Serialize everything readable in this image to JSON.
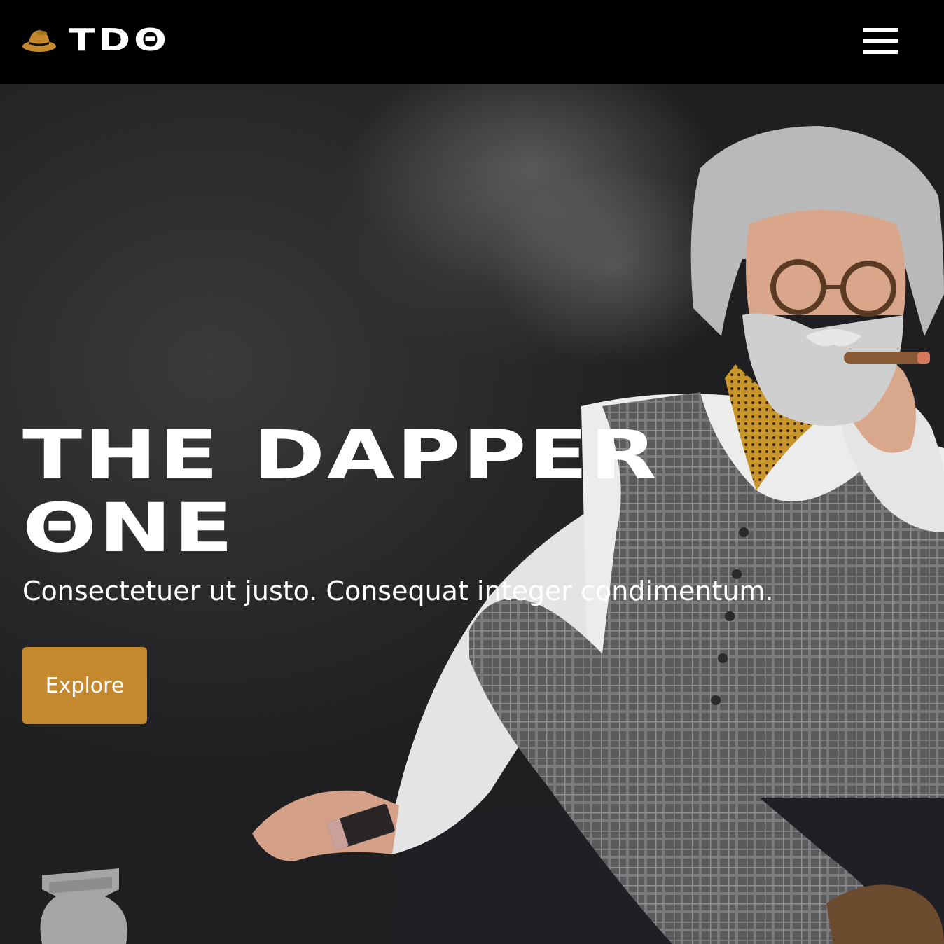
{
  "header": {
    "logo_text": "TDΘ",
    "logo_icon": "hat-icon",
    "menu_icon": "hamburger-menu-icon"
  },
  "hero": {
    "title_line1": "THE DAPPER",
    "title_line2": "ΘNE",
    "subtitle": "Consectetuer ut justo. Consequat integer condimentum.",
    "cta_label": "Explore",
    "image_subject": "gentleman-smoking-cigar-photo"
  },
  "colors": {
    "accent": "#c4892f",
    "header_bg": "#000000",
    "hero_bg": "#2a2a2c",
    "text": "#ffffff"
  }
}
